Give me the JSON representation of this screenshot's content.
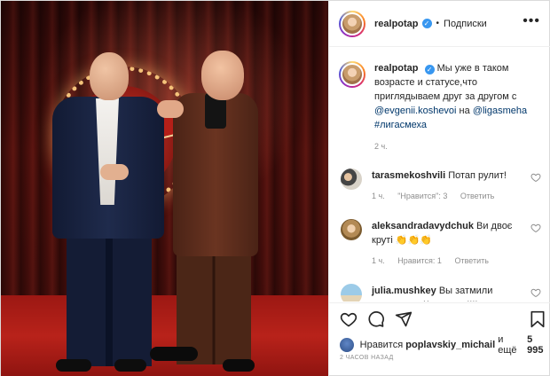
{
  "post": {
    "username": "realpotap",
    "follow_label": "Подписки",
    "caption_text_1": "Мы уже в таком возрасте и статусе,что приглядываем друг за другом с ",
    "mention_1": "@evgenii.koshevoi",
    "caption_text_2": " на ",
    "mention_2": "@ligasmeha",
    "hashtag": "#лигасмеха",
    "caption_time": "2 ч."
  },
  "comments": [
    {
      "username": "tarasmekoshvili",
      "text": "Потап рулит!",
      "time": "1 ч.",
      "likes": "\"Нравится\": 3",
      "reply": "Ответить"
    },
    {
      "username": "aleksandradavydchuk",
      "text": "Ви двоє круті 👏👏👏",
      "time": "1 ч.",
      "likes": "Нравится: 1",
      "reply": "Ответить"
    },
    {
      "username": "julia.mushkey",
      "text": "Вы затмили полностью Кошевого!!!! красавчик очень интересный в",
      "time": "",
      "likes": "",
      "reply": ""
    }
  ],
  "likes_bar": {
    "prefix": "Нравится",
    "user": "poplavskiy_michail",
    "suffix": "и ещё",
    "count": "5 995",
    "timestamp": "2 ЧАСОВ НАЗАД"
  },
  "icons": {
    "like": "heart-icon",
    "comment": "comment-icon",
    "share": "share-icon",
    "save": "bookmark-icon",
    "more": "more-icon",
    "verified": "verified-icon"
  },
  "colors": {
    "link": "#00376b",
    "verified": "#3897f0",
    "meta": "#8e8e8e"
  }
}
